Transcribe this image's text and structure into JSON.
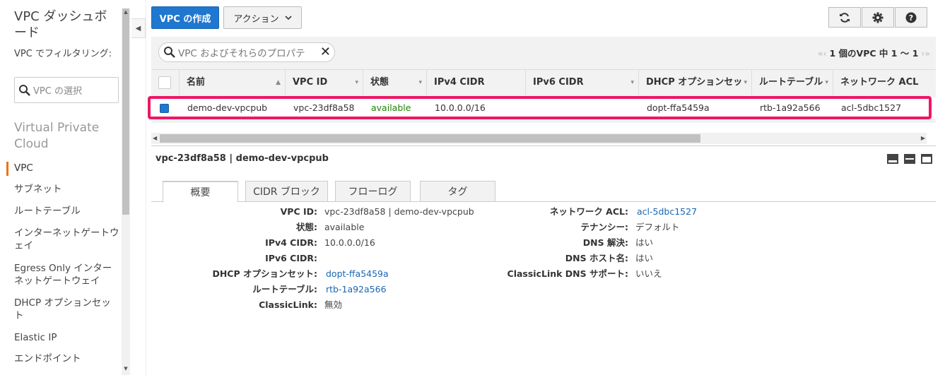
{
  "sidebar": {
    "title": "VPC ダッシュボード",
    "filter_label": "VPC でフィルタリング:",
    "vpc_select_placeholder": "VPC の選択",
    "section_title": "Virtual Private Cloud",
    "items": [
      {
        "label": "VPC",
        "active": true
      },
      {
        "label": "サブネット"
      },
      {
        "label": "ルートテーブル"
      },
      {
        "label": "インターネットゲートウェイ"
      },
      {
        "label": "Egress Only インターネットゲートウェイ"
      },
      {
        "label": "DHCP オプションセット"
      },
      {
        "label": "Elastic IP"
      },
      {
        "label": "エンドポイント"
      }
    ]
  },
  "toolbar": {
    "create_vpc": "VPC の作成",
    "actions": "アクション",
    "icons": [
      "refresh-icon",
      "gear-icon",
      "help-icon"
    ]
  },
  "search": {
    "placeholder": "VPC およびそれらのプロパテ"
  },
  "pager": {
    "text": "1 個のVPC 中 1 ～ 1"
  },
  "table": {
    "columns": [
      "名前",
      "VPC ID",
      "状態",
      "IPv4 CIDR",
      "IPv6 CIDR",
      "DHCP オプションセッ",
      "ルートテーブル",
      "ネットワーク ACL"
    ],
    "rows": [
      {
        "selected": true,
        "name": "demo-dev-vpcpub",
        "vpc_id": "vpc-23df8a58",
        "state": "available",
        "ipv4_cidr": "10.0.0.0/16",
        "ipv6_cidr": "",
        "dhcp": "dopt-ffa5459a",
        "route_table": "rtb-1a92a566",
        "network_acl": "acl-5dbc1527"
      }
    ]
  },
  "detail": {
    "title": "vpc-23df8a58 | demo-dev-vpcpub",
    "tabs": [
      "概要",
      "CIDR ブロック",
      "フローログ",
      "タグ"
    ],
    "left": [
      {
        "key": "VPC ID:",
        "value": "vpc-23df8a58 | demo-dev-vpcpub",
        "link": false
      },
      {
        "key": "状態:",
        "value": "available",
        "link": false
      },
      {
        "key": "IPv4 CIDR:",
        "value": "10.0.0.0/16",
        "link": false
      },
      {
        "key": "IPv6 CIDR:",
        "value": "",
        "link": false
      },
      {
        "key": "DHCP オプションセット:",
        "value": "dopt-ffa5459a",
        "link": true
      },
      {
        "key": "ルートテーブル:",
        "value": "rtb-1a92a566",
        "link": true
      },
      {
        "key": "ClassicLink:",
        "value": "無効",
        "link": false
      }
    ],
    "right": [
      {
        "key": "ネットワーク ACL:",
        "value": "acl-5dbc1527",
        "link": true
      },
      {
        "key": "テナンシー:",
        "value": "デフォルト",
        "link": false
      },
      {
        "key": "DNS 解決:",
        "value": "はい",
        "link": false
      },
      {
        "key": "DNS ホスト名:",
        "value": "はい",
        "link": false
      },
      {
        "key": "ClassicLink DNS サポート:",
        "value": "いいえ",
        "link": false
      }
    ]
  }
}
